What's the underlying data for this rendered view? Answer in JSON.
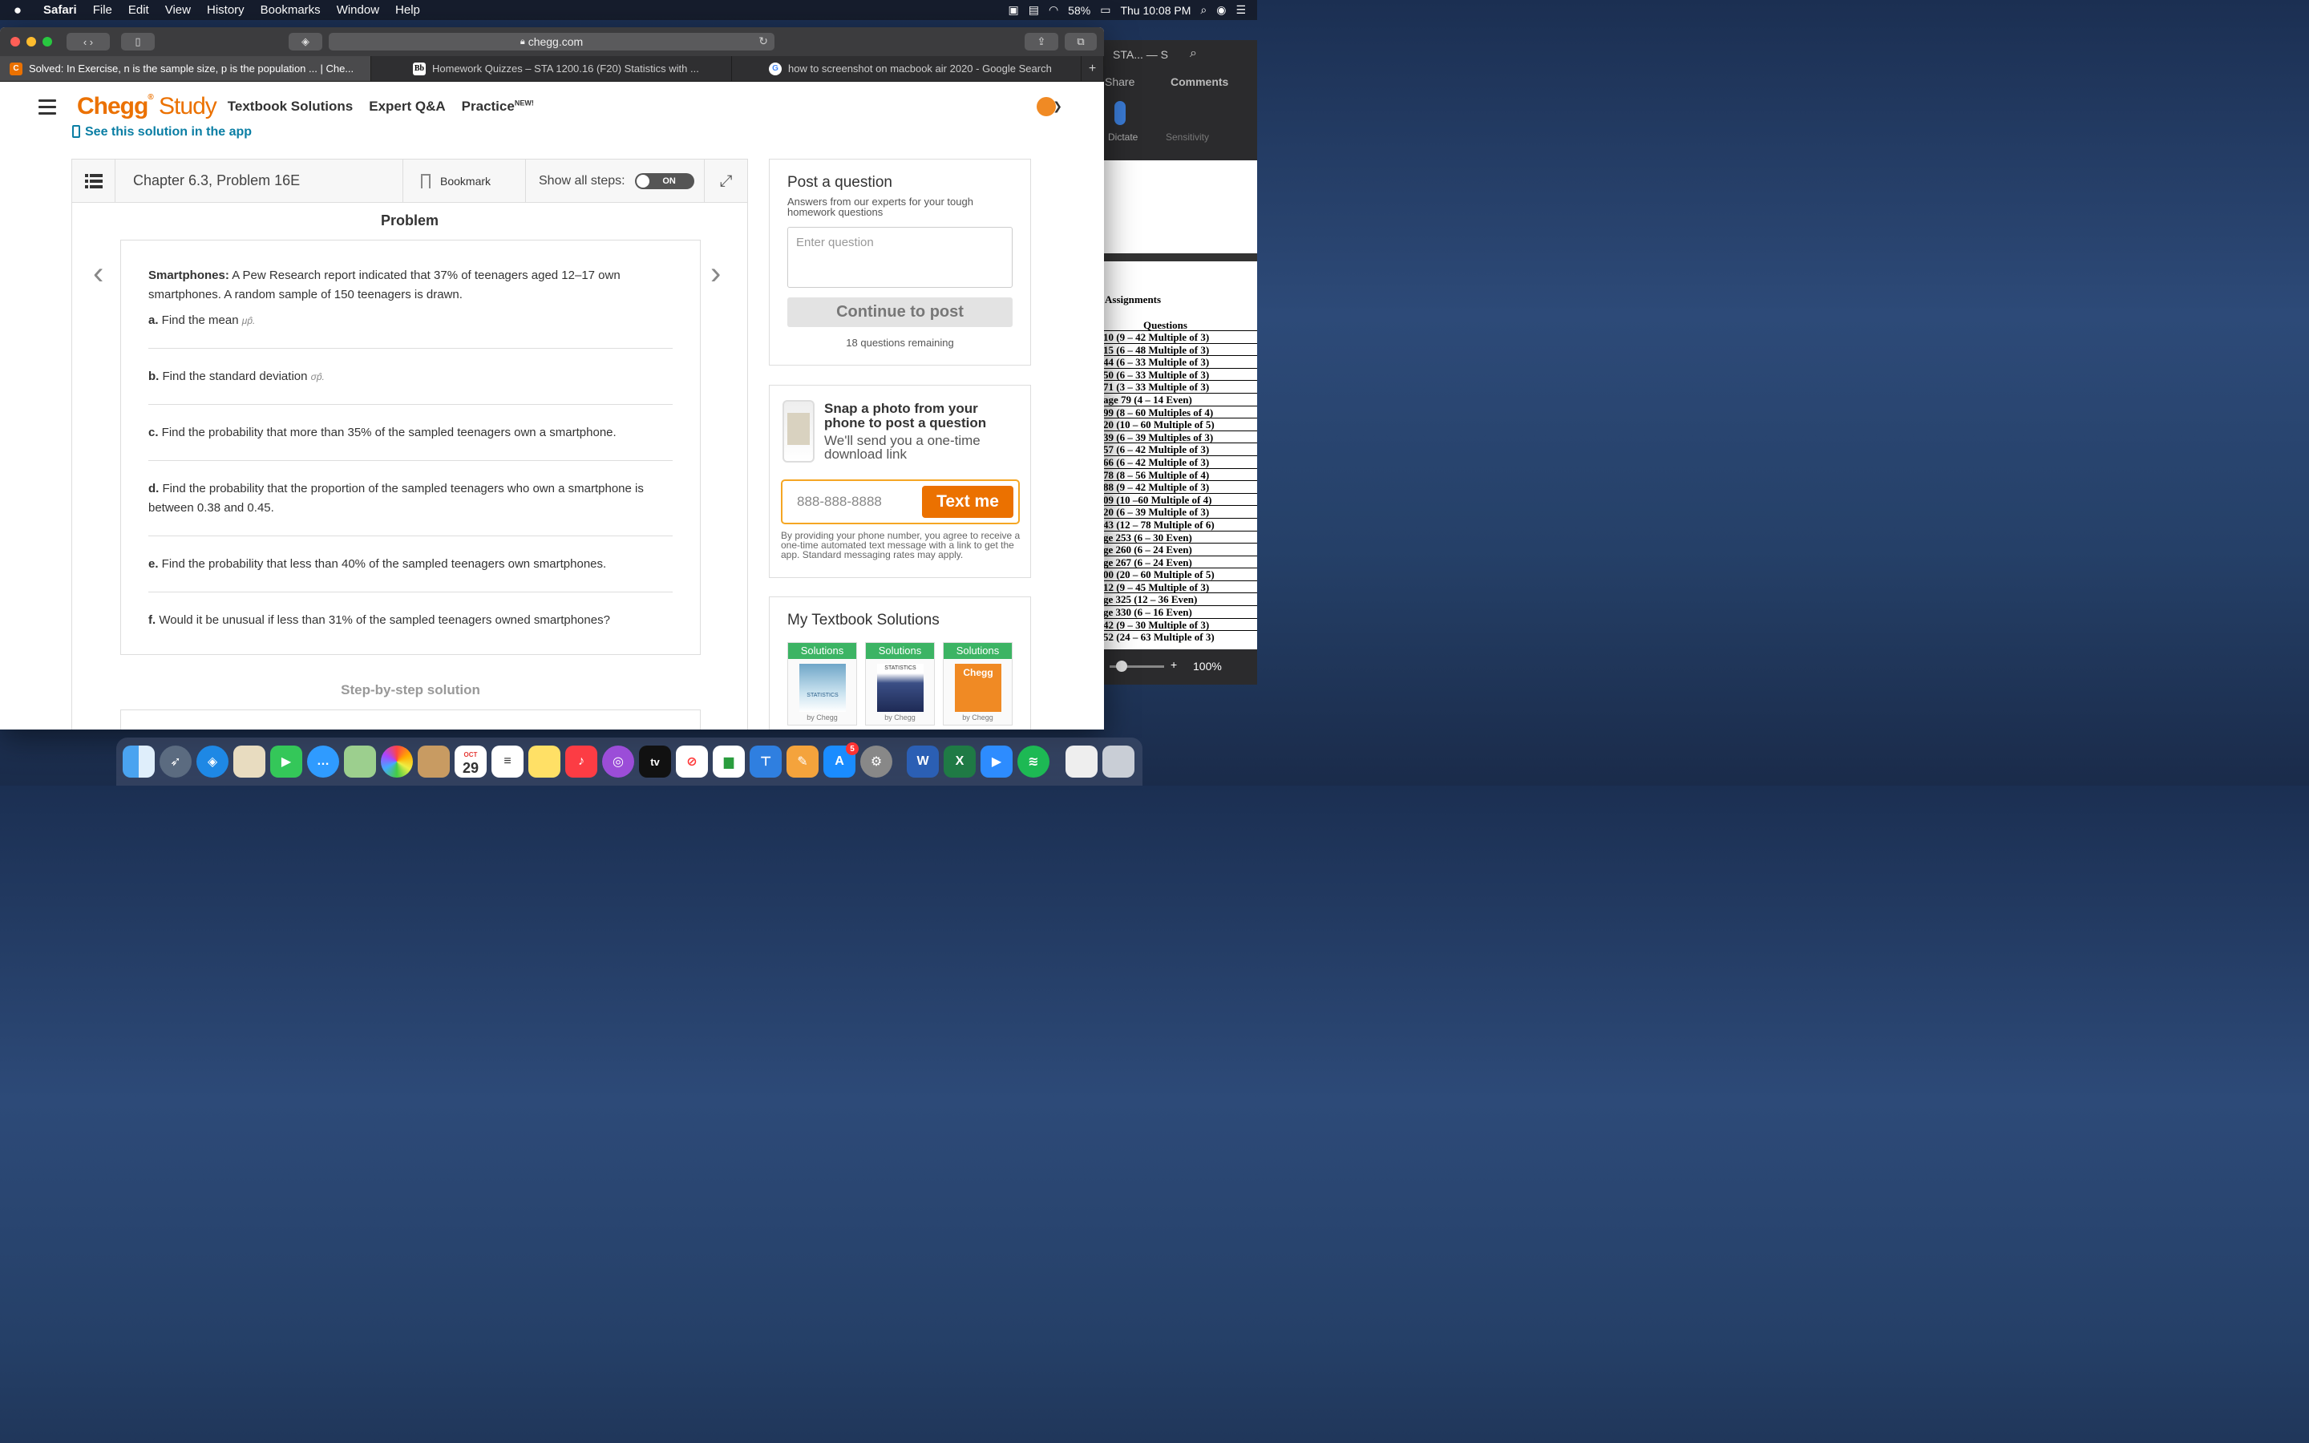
{
  "menubar": {
    "apple": "",
    "items": [
      "Safari",
      "File",
      "Edit",
      "View",
      "History",
      "Bookmarks",
      "Window",
      "Help"
    ],
    "battery": "58%",
    "clock": "Thu 10:08 PM"
  },
  "browser": {
    "url": "chegg.com",
    "tabs": [
      {
        "label": "Solved: In Exercise, n is the sample size, p is the population ... | Che...",
        "fav": "C"
      },
      {
        "label": "Homework Quizzes – STA 1200.16 (F20) Statistics with ...",
        "fav": "Bb"
      },
      {
        "label": "how to screenshot on macbook air 2020 - Google Search",
        "fav": "G"
      }
    ]
  },
  "nav": {
    "logo_a": "Chegg",
    "logo_b": "Study",
    "links": [
      "Textbook Solutions",
      "Expert Q&A",
      "Practice"
    ],
    "new_badge": "NEW!",
    "see_app": "See this solution in the app"
  },
  "problem": {
    "chapter": "Chapter 6.3, Problem 16E",
    "bookmark": "Bookmark",
    "show_steps": "Show all steps:",
    "toggle": "ON",
    "heading": "Problem",
    "intro_bold": "Smartphones:",
    "intro": " A Pew Research report indicated that 37% of teenagers aged 12–17 own smartphones. A random sample of 150 teenagers is drawn.",
    "parts": [
      {
        "letter": "a.",
        "text": " Find the mean ",
        "sym": "μp̂."
      },
      {
        "letter": "b.",
        "text": " Find the standard deviation ",
        "sym": "σp̂."
      },
      {
        "letter": "c.",
        "text": " Find the probability that more than 35% of the sampled teenagers own a smartphone.",
        "sym": ""
      },
      {
        "letter": "d.",
        "text": " Find the probability that the proportion of the sampled teenagers who own a smartphone is between 0.38 and 0.45.",
        "sym": ""
      },
      {
        "letter": "e.",
        "text": " Find the probability that less than 40% of the sampled teenagers own smartphones.",
        "sym": ""
      },
      {
        "letter": "f.",
        "text": " Would it be unusual if less than 31% of the sampled teenagers owned smartphones?",
        "sym": ""
      }
    ],
    "step_heading": "Step-by-step solution"
  },
  "post": {
    "title": "Post a question",
    "subtitle": "Answers from our experts for your tough homework questions",
    "placeholder": "Enter question",
    "button": "Continue to post",
    "remaining": "18 questions remaining"
  },
  "snap": {
    "title": "Snap a photo from your phone to post a question",
    "body": "We'll send you a one-time download link",
    "phone_placeholder": "888-888-8888",
    "button": "Text me",
    "disclaimer": "By providing your phone number, you agree to receive a one-time automated text message with a link to get the app. Standard messaging rates may apply."
  },
  "mytb": {
    "title": "My Textbook Solutions",
    "books": [
      {
        "header": "Solutions",
        "cover": "STATISTICS",
        "by": "by Chegg"
      },
      {
        "header": "Solutions",
        "cover": "STATISTICS",
        "by": "by Chegg"
      },
      {
        "header": "Solutions",
        "cover": "Chegg",
        "by": "by Chegg"
      }
    ]
  },
  "rightwin": {
    "title": "STA... — S",
    "share": "Share",
    "comments": "Comments",
    "dictate": "Dictate",
    "sensitivity": "Sensitivity",
    "assignments": "Assignments",
    "questions_header": "Questions",
    "rows": [
      "10 (9 – 42 Multiple of 3)",
      "15 (6 – 48 Multiple of 3)",
      "44 (6 – 33 Multiple of 3)",
      "50 (6 – 33 Multiple of 3)",
      "71 (3 – 33 Multiple of 3)",
      "age 79 (4 – 14 Even)",
      "99 (8 – 60 Multiples of 4)",
      "20 (10 – 60 Multiple of 5)",
      "39 (6 – 39 Multiples of 3)",
      "57 (6 – 42 Multiple of 3)",
      "66 (6 – 42 Multiple of 3)",
      "78 (8 – 56 Multiple of 4)",
      "88 (9 – 42 Multiple of 3)",
      "09 (10 –60 Multiple of 4)",
      "20 (6 – 39 Multiple of 3)",
      "43 (12 – 78 Multiple of 6)",
      "ge 253 (6 – 30 Even)",
      "ge 260 (6 – 24 Even)",
      "ge 267 (6 – 24 Even)",
      "00 (20 – 60 Multiple of 5)",
      "12 (9 – 45 Multiple of 3)",
      "ge 325 (12 – 36 Even)",
      "ge 330 (6 – 16 Even)",
      "42 (9 – 30 Multiple of 3)",
      "52 (24 – 63 Multiple of 3)"
    ],
    "zoom": "100%"
  },
  "dock": {
    "calendar_month": "OCT",
    "calendar_day": "29",
    "appstore_badge": "5",
    "tv_label": "tv",
    "word": "W",
    "excel": "X"
  }
}
